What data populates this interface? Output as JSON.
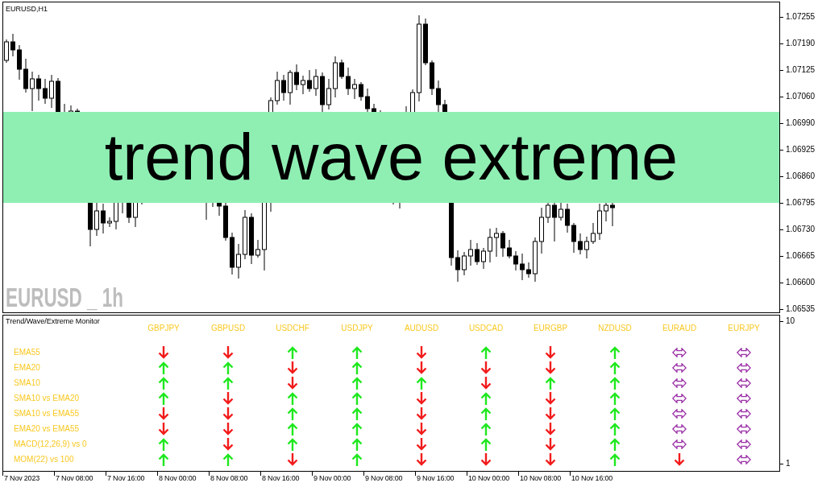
{
  "chart": {
    "symbol_label": "EURUSD,H1",
    "overlay_label": "EURUSD _ 1h",
    "banner": "trend wave extreme",
    "price_axis": [
      "1.07255",
      "1.07190",
      "1.07125",
      "1.07060",
      "1.06990",
      "1.06925",
      "1.06860",
      "1.06795",
      "1.06730",
      "1.06665",
      "1.06600",
      "1.06535"
    ]
  },
  "monitor": {
    "title": "Trend/Wave/Extreme Monitor",
    "symbols": [
      "GBPJPY",
      "GBPUSD",
      "USDCHF",
      "USDJPY",
      "AUDUSD",
      "USDCAD",
      "EURGBP",
      "NZDUSD",
      "EURAUD",
      "EURJPY"
    ],
    "rows": [
      {
        "label": "EMA55",
        "signals": [
          {
            "kind": "down"
          },
          {
            "kind": "down"
          },
          {
            "kind": "up"
          },
          {
            "kind": "up"
          },
          {
            "kind": "down"
          },
          {
            "kind": "up"
          },
          {
            "kind": "down"
          },
          {
            "kind": "up"
          },
          {
            "kind": "both"
          },
          {
            "kind": "both"
          }
        ]
      },
      {
        "label": "EMA20",
        "signals": [
          {
            "kind": "up"
          },
          {
            "kind": "up"
          },
          {
            "kind": "down"
          },
          {
            "kind": "up"
          },
          {
            "kind": "down"
          },
          {
            "kind": "down"
          },
          {
            "kind": "down"
          },
          {
            "kind": "up"
          },
          {
            "kind": "both"
          },
          {
            "kind": "both"
          }
        ]
      },
      {
        "label": "SMA10",
        "signals": [
          {
            "kind": "up"
          },
          {
            "kind": "up"
          },
          {
            "kind": "down"
          },
          {
            "kind": "up"
          },
          {
            "kind": "up"
          },
          {
            "kind": "down"
          },
          {
            "kind": "up"
          },
          {
            "kind": "up"
          },
          {
            "kind": "both"
          },
          {
            "kind": "both"
          }
        ]
      },
      {
        "label": "SMA10 vs EMA20",
        "signals": [
          {
            "kind": "up"
          },
          {
            "kind": "down"
          },
          {
            "kind": "up"
          },
          {
            "kind": "up"
          },
          {
            "kind": "down"
          },
          {
            "kind": "up"
          },
          {
            "kind": "down"
          },
          {
            "kind": "up"
          },
          {
            "kind": "both"
          },
          {
            "kind": "both"
          }
        ]
      },
      {
        "label": "SMA10 vs EMA55",
        "signals": [
          {
            "kind": "down"
          },
          {
            "kind": "down"
          },
          {
            "kind": "up"
          },
          {
            "kind": "up"
          },
          {
            "kind": "down"
          },
          {
            "kind": "up"
          },
          {
            "kind": "down"
          },
          {
            "kind": "up"
          },
          {
            "kind": "both"
          },
          {
            "kind": "both"
          }
        ]
      },
      {
        "label": "EMA20 vs EMA55",
        "signals": [
          {
            "kind": "down"
          },
          {
            "kind": "down"
          },
          {
            "kind": "up"
          },
          {
            "kind": "up"
          },
          {
            "kind": "down"
          },
          {
            "kind": "up"
          },
          {
            "kind": "down"
          },
          {
            "kind": "up"
          },
          {
            "kind": "both"
          },
          {
            "kind": "both"
          }
        ]
      },
      {
        "label": "MACD(12,26,9) vs 0",
        "signals": [
          {
            "kind": "up"
          },
          {
            "kind": "down"
          },
          {
            "kind": "up"
          },
          {
            "kind": "up"
          },
          {
            "kind": "down"
          },
          {
            "kind": "up"
          },
          {
            "kind": "down"
          },
          {
            "kind": "up"
          },
          {
            "kind": "both"
          },
          {
            "kind": "both"
          }
        ]
      },
      {
        "label": "MOM(22) vs 100",
        "signals": [
          {
            "kind": "up"
          },
          {
            "kind": "up"
          },
          {
            "kind": "down"
          },
          {
            "kind": "up"
          },
          {
            "kind": "down"
          },
          {
            "kind": "down"
          },
          {
            "kind": "down"
          },
          {
            "kind": "up"
          },
          {
            "kind": "down"
          },
          {
            "kind": "both"
          }
        ]
      }
    ],
    "axis_labels": [
      "10",
      "1"
    ]
  },
  "time_axis": [
    "7 Nov 2023",
    "7 Nov 08:00",
    "7 Nov 16:00",
    "8 Nov 00:00",
    "8 Nov 08:00",
    "8 Nov 16:00",
    "9 Nov 00:00",
    "9 Nov 08:00",
    "9 Nov 16:00",
    "10 Nov 00:00",
    "10 Nov 08:00",
    "10 Nov 16:00"
  ]
}
